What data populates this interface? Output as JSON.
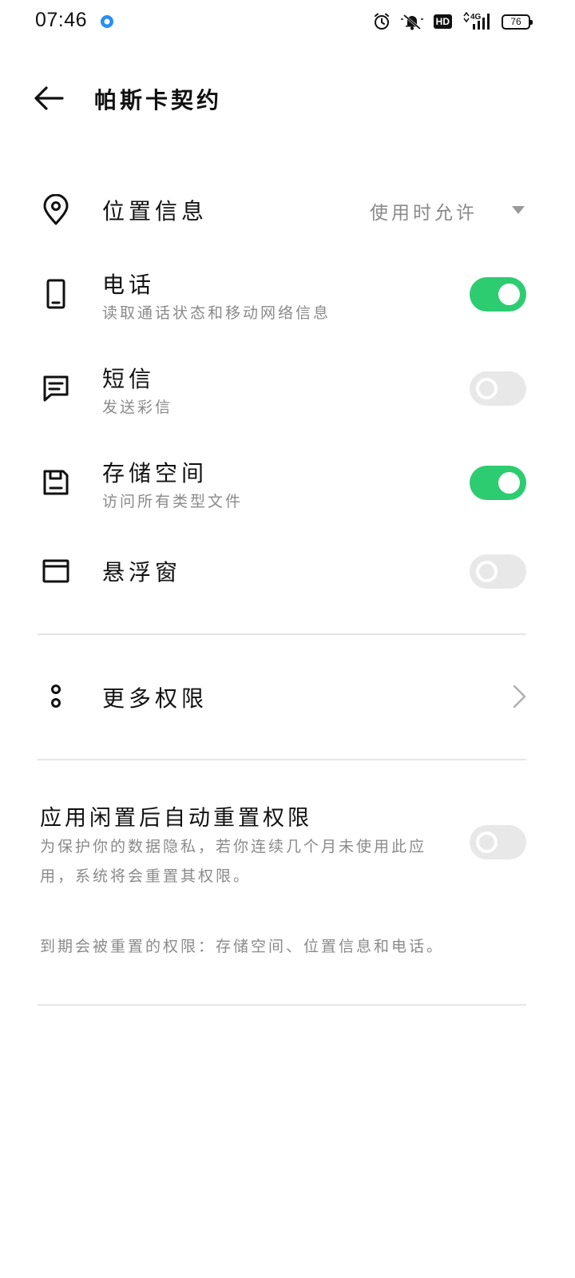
{
  "status_bar": {
    "time": "07:46",
    "network": "4G",
    "hd": "HD",
    "battery": "76"
  },
  "header": {
    "title": "帕斯卡契约"
  },
  "permissions": [
    {
      "icon": "location-pin-icon",
      "title": "位置信息",
      "value": "使用时允许"
    },
    {
      "icon": "phone-icon",
      "title": "电话",
      "subtitle": "读取通话状态和移动网络信息",
      "enabled": true
    },
    {
      "icon": "message-icon",
      "title": "短信",
      "subtitle": "发送彩信",
      "enabled": false
    },
    {
      "icon": "storage-icon",
      "title": "存储空间",
      "subtitle": "访问所有类型文件",
      "enabled": true
    },
    {
      "icon": "floating-window-icon",
      "title": "悬浮窗",
      "enabled": false
    }
  ],
  "more": {
    "label": "更多权限"
  },
  "auto_reset": {
    "title": "应用闲置后自动重置权限",
    "description": "为保护你的数据隐私，若你连续几个月未使用此应用，系统将会重置其权限。",
    "enabled": false
  },
  "expire_note": "到期会被重置的权限：存储空间、位置信息和电话。",
  "colors": {
    "toggle_on": "#2ecc71",
    "toggle_off": "#e8e8e8",
    "secondary_text": "#8a8a8a"
  }
}
